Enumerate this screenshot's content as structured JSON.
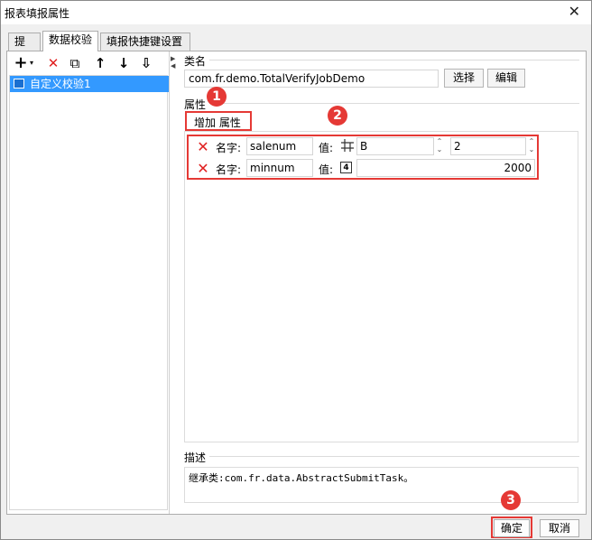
{
  "window": {
    "title": "报表填报属性",
    "close_glyph": "✕"
  },
  "tabs": [
    {
      "label": "提交",
      "active": false
    },
    {
      "label": "数据校验",
      "active": true
    },
    {
      "label": "填报快捷键设置",
      "active": false
    }
  ],
  "left": {
    "toolbar": [
      {
        "icon": "add-icon",
        "glyph": "+"
      },
      {
        "icon": "delete-icon",
        "glyph": "✕"
      },
      {
        "icon": "copy-icon",
        "glyph": "⧉"
      },
      {
        "icon": "move-up-icon",
        "glyph": "↑"
      },
      {
        "icon": "move-down-icon",
        "glyph": "↓"
      },
      {
        "icon": "sort-icon",
        "glyph": "⇩"
      }
    ],
    "items": [
      {
        "label": "自定义校验1",
        "selected": true
      }
    ]
  },
  "class_section": {
    "label": "类名",
    "value": "com.fr.demo.TotalVerifyJobDemo",
    "select_label": "选择",
    "edit_label": "编辑"
  },
  "props_section": {
    "label": "属性",
    "add_label": "增加 属性",
    "rows": [
      {
        "name_label": "名字:",
        "name_value": "salenum",
        "value_label": "值:",
        "value_icon": "cell-icon",
        "value1": "B",
        "value2": "2"
      },
      {
        "name_label": "名字:",
        "name_value": "minnum",
        "value_label": "值:",
        "value_icon": "number-icon",
        "number_glyph": "4",
        "value1": "2000"
      }
    ]
  },
  "desc_section": {
    "label": "描述",
    "text": "继承类:com.fr.data.AbstractSubmitTask。"
  },
  "badges": [
    "1",
    "2",
    "3"
  ],
  "footer": {
    "ok_label": "确定",
    "cancel_label": "取消"
  },
  "colors": {
    "accent": "#e53935",
    "selection": "#3399ff"
  }
}
